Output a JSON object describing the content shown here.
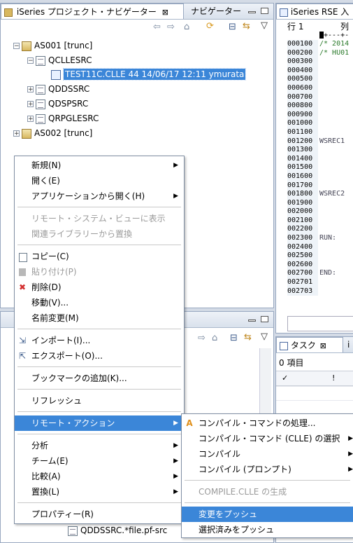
{
  "left_view": {
    "tab_title": "iSeries プロジェクト・ナビゲーター",
    "tab_close": "⊠",
    "tab2_title": "ナビゲーター"
  },
  "tree": {
    "as001": "AS001 [trunc]",
    "qcllesrc": "QCLLESRC",
    "test11c": "TEST11C.CLLE 44  14/06/17 12:11  ymurata",
    "qddssrc": "QDDSSRC",
    "qdspsrc": "QDSPSRC",
    "qrpglesrc": "QRPGLESRC",
    "as002": "AS002 [trunc]"
  },
  "editor": {
    "tab_title": "iSeries RSE 入",
    "header_row": "行 1",
    "header_col": "列",
    "ruler": "+---+-",
    "lines": [
      "000100",
      "000200",
      "000300",
      "000400",
      "000500",
      "000600",
      "000700",
      "000800",
      "000900",
      "001000",
      "001100",
      "001200",
      "001300",
      "001400",
      "001500",
      "001600",
      "001700",
      "001800",
      "001900",
      "002000",
      "002100",
      "002200",
      "002300",
      "002400",
      "002500",
      "002600",
      "002700",
      "002701",
      "002703"
    ],
    "code": [
      "/* 2014",
      "/* HU01",
      "",
      "",
      "",
      "",
      "",
      "",
      "",
      "",
      "",
      "WSREC1",
      "",
      "",
      "",
      "",
      "",
      "WSREC2",
      "",
      "",
      "",
      "",
      "RUN:",
      "",
      "",
      "",
      "END:",
      "",
      ""
    ]
  },
  "tasks": {
    "tab_title": "タスク",
    "tab_close": "⊠",
    "tab_next": "i",
    "count": "0 項目",
    "col_check": "✓",
    "col_priority": "!"
  },
  "bottom_tree": {
    "item": "QDDSSRC.*file.pf-src"
  },
  "context_menu": {
    "items": [
      {
        "label": "新規(N)",
        "submenu": true
      },
      {
        "label": "開く(E)"
      },
      {
        "label": "アプリケーションから開く(H)",
        "submenu": true
      },
      {
        "label": "リモート・システム・ビューに表示",
        "disabled": true
      },
      {
        "label": "関連ライブラリーから置換",
        "disabled": true
      },
      {
        "label": "コピー(C)"
      },
      {
        "label": "貼り付け(P)",
        "disabled": true
      },
      {
        "label": "削除(D)"
      },
      {
        "label": "移動(V)..."
      },
      {
        "label": "名前変更(M)"
      },
      {
        "label": "インポート(I)..."
      },
      {
        "label": "エクスポート(O)..."
      },
      {
        "label": "ブックマークの追加(K)..."
      },
      {
        "label": "リフレッシュ"
      },
      {
        "label": "リモート・アクション",
        "submenu": true
      },
      {
        "label": "分析",
        "submenu": true
      },
      {
        "label": "チーム(E)",
        "submenu": true
      },
      {
        "label": "比較(A)",
        "submenu": true
      },
      {
        "label": "置換(L)",
        "submenu": true
      },
      {
        "label": "プロパティー(R)"
      }
    ]
  },
  "submenu": {
    "items": [
      {
        "label": "コンパイル・コマンドの処理..."
      },
      {
        "label": "コンパイル・コマンド (CLLE) の選択",
        "submenu": true
      },
      {
        "label": "コンパイル",
        "submenu": true
      },
      {
        "label": "コンパイル (プロンプト)",
        "submenu": true
      },
      {
        "label": "COMPILE.CLLE の生成",
        "disabled": true
      },
      {
        "label": "変更をプッシュ"
      },
      {
        "label": "選択済みをプッシュ"
      }
    ]
  },
  "colors": {
    "highlight": "#3b86d8",
    "delete_icon": "#d32f2f"
  }
}
